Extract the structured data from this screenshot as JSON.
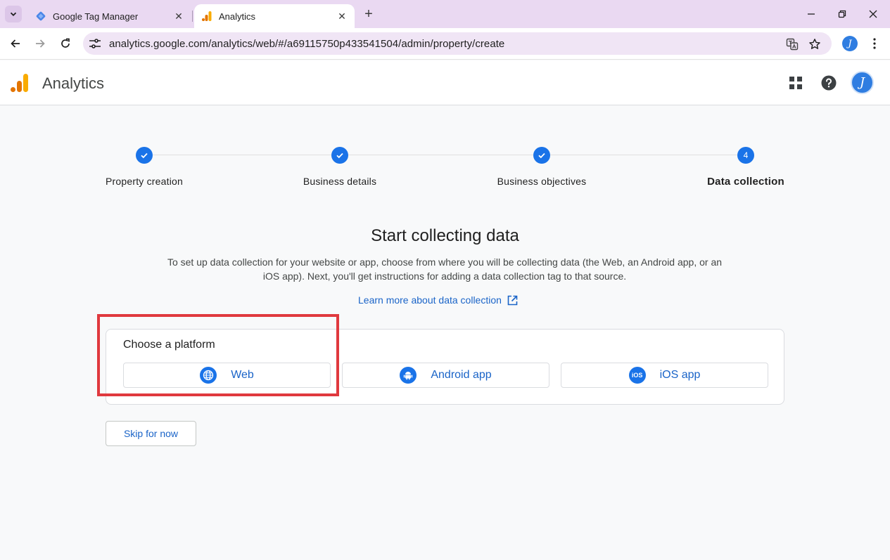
{
  "browser": {
    "tabs": [
      {
        "title": "Google Tag Manager",
        "active": false,
        "favicon": "gtm-diamond-icon"
      },
      {
        "title": "Analytics",
        "active": true,
        "favicon": "analytics-bars-icon"
      }
    ],
    "url": "analytics.google.com/analytics/web/#/a69115750p433541504/admin/property/create",
    "profile_initial": "J"
  },
  "app": {
    "name": "Analytics",
    "avatar_initial": "J"
  },
  "stepper": {
    "steps": [
      {
        "label": "Property creation",
        "state": "done"
      },
      {
        "label": "Business details",
        "state": "done"
      },
      {
        "label": "Business objectives",
        "state": "done"
      },
      {
        "label": "Data collection",
        "state": "current",
        "number": "4"
      }
    ]
  },
  "main": {
    "title": "Start collecting data",
    "description": "To set up data collection for your website or app, choose from where you will be collecting data (the Web, an Android app, or an iOS app). Next, you'll get instructions for adding a data collection tag to that source.",
    "learn_more": "Learn more about data collection",
    "platform_card": {
      "title": "Choose a platform",
      "options": [
        {
          "label": "Web",
          "icon": "globe-icon"
        },
        {
          "label": "Android app",
          "icon": "android-icon"
        },
        {
          "label": "iOS app",
          "icon": "ios-icon",
          "icon_text": "iOS"
        }
      ]
    },
    "skip_label": "Skip for now"
  },
  "colors": {
    "accent": "#1a73e8",
    "link": "#1a64c8",
    "highlight": "#e0393e",
    "tabbar": "#ead9f2"
  }
}
